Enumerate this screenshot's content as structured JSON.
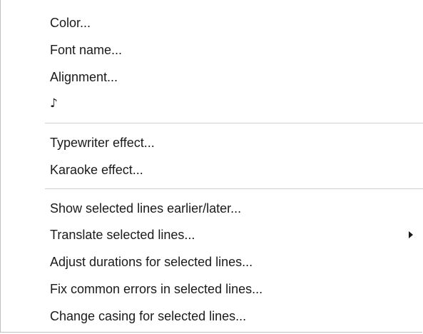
{
  "menu": {
    "group1": [
      {
        "label": "Color..."
      },
      {
        "label": "Font name..."
      },
      {
        "label": "Alignment..."
      },
      {
        "label": "♪"
      }
    ],
    "group2": [
      {
        "label": "Typewriter effect..."
      },
      {
        "label": "Karaoke effect..."
      }
    ],
    "group3": [
      {
        "label": "Show selected lines earlier/later..."
      },
      {
        "label": "Translate selected lines...",
        "submenu_icon": "submenu-arrow-icon"
      },
      {
        "label": "Adjust durations for selected lines..."
      },
      {
        "label": "Fix common errors in selected lines..."
      },
      {
        "label": "Change casing for selected lines..."
      }
    ]
  }
}
